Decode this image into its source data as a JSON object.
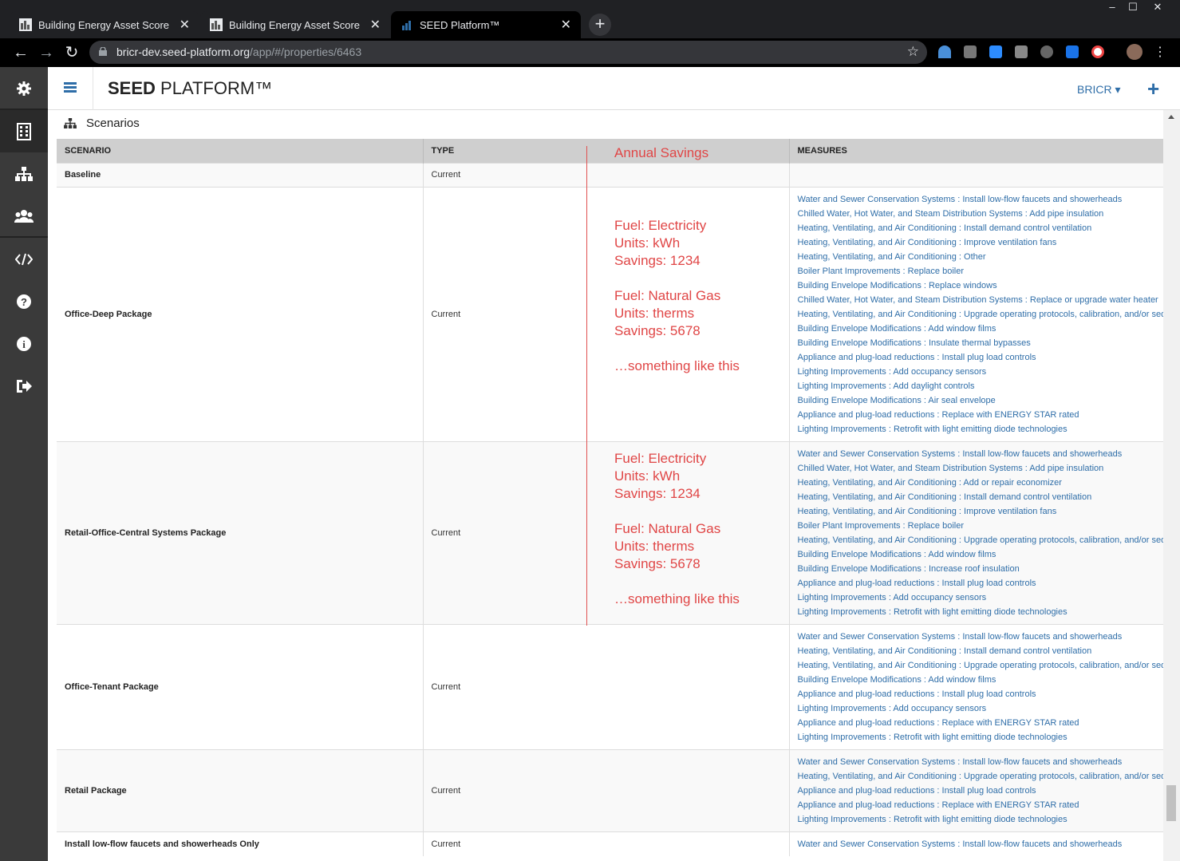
{
  "browser": {
    "tabs": [
      {
        "label": "Building Energy Asset Score",
        "active": false
      },
      {
        "label": "Building Energy Asset Score",
        "active": false
      },
      {
        "label": "SEED Platform™",
        "active": true
      }
    ],
    "url_host": "bricr-dev.seed-platform.org",
    "url_path": "/app/#/properties/6463",
    "window_controls": {
      "minimize": "‒",
      "maximize": "☐",
      "close": "✕"
    }
  },
  "app": {
    "brand_bold": "SEED",
    "brand_rest": " PLATFORM™",
    "org_menu": "BRICR ▾",
    "add_label": "+",
    "accent": "#2f6ea8"
  },
  "sidebar_icons": [
    "gear-icon",
    "building-icon",
    "sitemap-icon",
    "users-icon",
    "code-icon",
    "help-icon",
    "info-icon",
    "logout-icon"
  ],
  "section": {
    "title": "Scenarios"
  },
  "table": {
    "headers": {
      "scenario": "SCENARIO",
      "type": "TYPE",
      "measures": "MEASURES"
    },
    "rows": [
      {
        "name": "Baseline",
        "type": "Current",
        "measures": []
      },
      {
        "name": "Office-Deep Package",
        "type": "Current",
        "measures": [
          "Water and Sewer Conservation Systems : Install low-flow faucets and showerheads",
          "Chilled Water, Hot Water, and Steam Distribution Systems : Add pipe insulation",
          "Heating, Ventilating, and Air Conditioning : Install demand control ventilation",
          "Heating, Ventilating, and Air Conditioning : Improve ventilation fans",
          "Heating, Ventilating, and Air Conditioning : Other",
          "Boiler Plant Improvements : Replace boiler",
          "Building Envelope Modifications : Replace windows",
          "Chilled Water, Hot Water, and Steam Distribution Systems : Replace or upgrade water heater",
          "Heating, Ventilating, and Air Conditioning : Upgrade operating protocols, calibration, and/or sequencing",
          "Building Envelope Modifications : Add window films",
          "Building Envelope Modifications : Insulate thermal bypasses",
          "Appliance and plug-load reductions : Install plug load controls",
          "Lighting Improvements : Add occupancy sensors",
          "Lighting Improvements : Add daylight controls",
          "Building Envelope Modifications : Air seal envelope",
          "Appliance and plug-load reductions : Replace with ENERGY STAR rated",
          "Lighting Improvements : Retrofit with light emitting diode technologies"
        ]
      },
      {
        "name": "Retail-Office-Central Systems Package",
        "type": "Current",
        "measures": [
          "Water and Sewer Conservation Systems : Install low-flow faucets and showerheads",
          "Chilled Water, Hot Water, and Steam Distribution Systems : Add pipe insulation",
          "Heating, Ventilating, and Air Conditioning : Add or repair economizer",
          "Heating, Ventilating, and Air Conditioning : Install demand control ventilation",
          "Heating, Ventilating, and Air Conditioning : Improve ventilation fans",
          "Boiler Plant Improvements : Replace boiler",
          "Heating, Ventilating, and Air Conditioning : Upgrade operating protocols, calibration, and/or sequencing",
          "Building Envelope Modifications : Add window films",
          "Building Envelope Modifications : Increase roof insulation",
          "Appliance and plug-load reductions : Install plug load controls",
          "Lighting Improvements : Add occupancy sensors",
          "Lighting Improvements : Retrofit with light emitting diode technologies"
        ]
      },
      {
        "name": "Office-Tenant Package",
        "type": "Current",
        "measures": [
          "Water and Sewer Conservation Systems : Install low-flow faucets and showerheads",
          "Heating, Ventilating, and Air Conditioning : Install demand control ventilation",
          "Heating, Ventilating, and Air Conditioning : Upgrade operating protocols, calibration, and/or sequencing",
          "Building Envelope Modifications : Add window films",
          "Appliance and plug-load reductions : Install plug load controls",
          "Lighting Improvements : Add occupancy sensors",
          "Appliance and plug-load reductions : Replace with ENERGY STAR rated",
          "Lighting Improvements : Retrofit with light emitting diode technologies"
        ]
      },
      {
        "name": "Retail Package",
        "type": "Current",
        "measures": [
          "Water and Sewer Conservation Systems : Install low-flow faucets and showerheads",
          "Heating, Ventilating, and Air Conditioning : Upgrade operating protocols, calibration, and/or sequencing",
          "Appliance and plug-load reductions : Install plug load controls",
          "Appliance and plug-load reductions : Replace with ENERGY STAR rated",
          "Lighting Improvements : Retrofit with light emitting diode technologies"
        ]
      },
      {
        "name": "Install low-flow faucets and showerheads Only",
        "type": "Current",
        "measures": [
          "Water and Sewer Conservation Systems : Install low-flow faucets and showerheads"
        ]
      }
    ]
  },
  "annotation": {
    "header": "Annual Savings",
    "block1": "Fuel: Electricity\nUnits: kWh\nSavings: 1234\n\nFuel: Natural Gas\nUnits: therms\nSavings: 5678\n\n…something like this",
    "block2": "Fuel: Electricity\nUnits: kWh\nSavings: 1234\n\nFuel: Natural Gas\nUnits: therms\nSavings: 5678\n\n…something like this",
    "color": "#e04646"
  }
}
